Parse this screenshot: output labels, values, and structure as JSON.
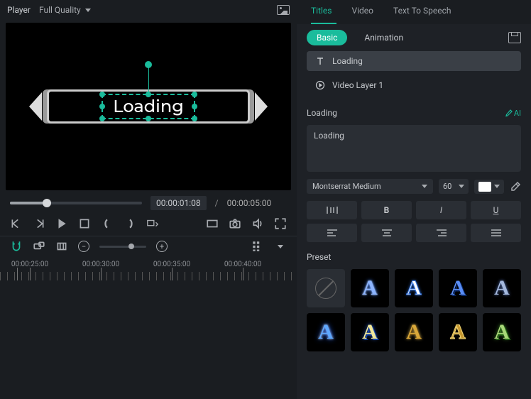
{
  "player": {
    "label": "Player",
    "quality": "Full Quality"
  },
  "preview": {
    "title_text": "Loading"
  },
  "playback": {
    "current_time": "00:00:01:08",
    "total_time": "00:00:05:00",
    "separator": "/"
  },
  "ruler_labels": [
    "00:00:25:00",
    "00:00:30:00",
    "00:00:35:00",
    "00:00:40:00"
  ],
  "tabs": {
    "titles": "Titles",
    "video": "Video",
    "tts": "Text To Speech"
  },
  "subtabs": {
    "basic": "Basic",
    "animation": "Animation"
  },
  "layers": {
    "loading_label": "Loading",
    "video_layer_label": "Video Layer 1"
  },
  "section_title": "Loading",
  "ai_label": "AI",
  "text_value": "Loading",
  "font": {
    "family": "Montserrat Medium",
    "size": "60",
    "color": "#ffffff"
  },
  "format_labels": {
    "bold": "B",
    "italic": "I",
    "underline": "U"
  },
  "preset_label": "Preset"
}
